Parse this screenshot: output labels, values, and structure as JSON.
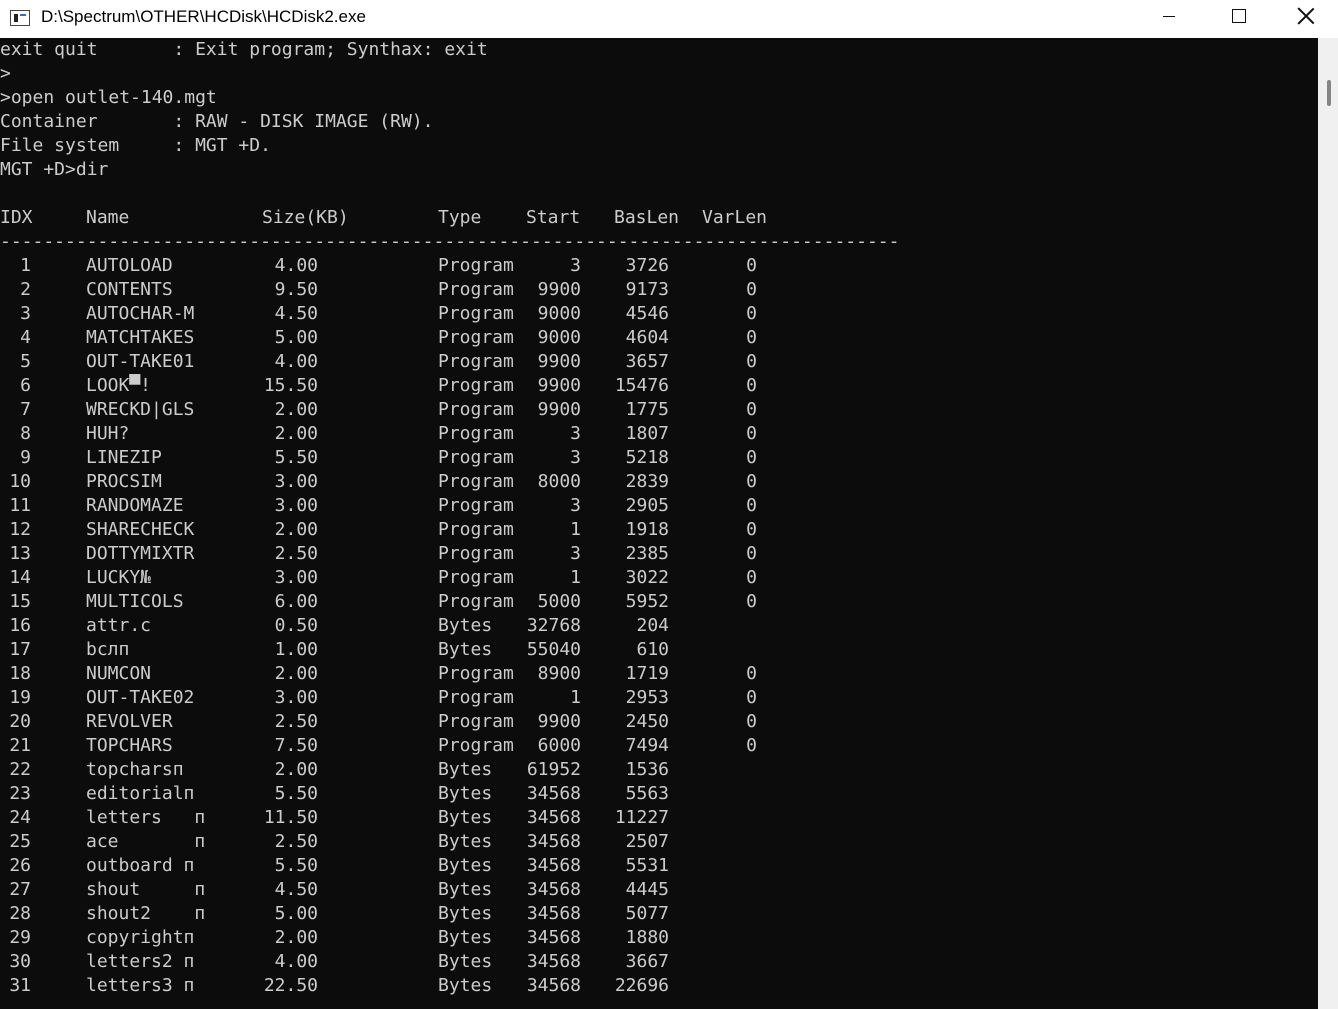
{
  "window": {
    "title": "D:\\Spectrum\\OTHER\\HCDisk\\HCDisk2.exe"
  },
  "console": {
    "pre_lines": [
      "exit quit       : Exit program; Synthax: exit",
      ">",
      ">open outlet-140.mgt",
      "Container       : RAW - DISK IMAGE (RW).",
      "File system     : MGT +D.",
      "MGT +D>dir",
      ""
    ],
    "headers": {
      "idx": "IDX",
      "name": "Name",
      "size": "Size(KB)",
      "type": "Type",
      "start": "Start",
      "baslen": "BasLen",
      "varlen": "VarLen"
    },
    "separator": "-----------------------------------------------------------------------------------",
    "rows": [
      {
        "idx": "1",
        "name": "AUTOLOAD",
        "size": "4.00",
        "type": "Program",
        "start": "3",
        "baslen": "3726",
        "varlen": "0"
      },
      {
        "idx": "2",
        "name": "CONTENTS",
        "size": "9.50",
        "type": "Program",
        "start": "9900",
        "baslen": "9173",
        "varlen": "0"
      },
      {
        "idx": "3",
        "name": "AUTOCHAR-M",
        "size": "4.50",
        "type": "Program",
        "start": "9000",
        "baslen": "4546",
        "varlen": "0"
      },
      {
        "idx": "4",
        "name": "MATCHTAKES",
        "size": "5.00",
        "type": "Program",
        "start": "9000",
        "baslen": "4604",
        "varlen": "0"
      },
      {
        "idx": "5",
        "name": "OUT-TAKE01",
        "size": "4.00",
        "type": "Program",
        "start": "9900",
        "baslen": "3657",
        "varlen": "0"
      },
      {
        "idx": "6",
        "name": "LOOK▀!",
        "size": "15.50",
        "type": "Program",
        "start": "9900",
        "baslen": "15476",
        "varlen": "0"
      },
      {
        "idx": "7",
        "name": "WRECKD|GLS",
        "size": "2.00",
        "type": "Program",
        "start": "9900",
        "baslen": "1775",
        "varlen": "0"
      },
      {
        "idx": "8",
        "name": "HUH?",
        "size": "2.00",
        "type": "Program",
        "start": "3",
        "baslen": "1807",
        "varlen": "0"
      },
      {
        "idx": "9",
        "name": "LINEZIP",
        "size": "5.50",
        "type": "Program",
        "start": "3",
        "baslen": "5218",
        "varlen": "0"
      },
      {
        "idx": "10",
        "name": "PROCSIM",
        "size": "3.00",
        "type": "Program",
        "start": "8000",
        "baslen": "2839",
        "varlen": "0"
      },
      {
        "idx": "11",
        "name": "RANDOMAZE",
        "size": "3.00",
        "type": "Program",
        "start": "3",
        "baslen": "2905",
        "varlen": "0"
      },
      {
        "idx": "12",
        "name": "SHARECHECK",
        "size": "2.00",
        "type": "Program",
        "start": "1",
        "baslen": "1918",
        "varlen": "0"
      },
      {
        "idx": "13",
        "name": "DOTTYMIXTR",
        "size": "2.50",
        "type": "Program",
        "start": "3",
        "baslen": "2385",
        "varlen": "0"
      },
      {
        "idx": "14",
        "name": "LUCKY№",
        "size": "3.00",
        "type": "Program",
        "start": "1",
        "baslen": "3022",
        "varlen": "0"
      },
      {
        "idx": "15",
        "name": "MULTICOLS",
        "size": "6.00",
        "type": "Program",
        "start": "5000",
        "baslen": "5952",
        "varlen": "0"
      },
      {
        "idx": "16",
        "name": "attr.c",
        "size": "0.50",
        "type": "Bytes",
        "start": "32768",
        "baslen": "204",
        "varlen": ""
      },
      {
        "idx": "17",
        "name": "bслп",
        "size": "1.00",
        "type": "Bytes",
        "start": "55040",
        "baslen": "610",
        "varlen": ""
      },
      {
        "idx": "18",
        "name": "NUMCON",
        "size": "2.00",
        "type": "Program",
        "start": "8900",
        "baslen": "1719",
        "varlen": "0"
      },
      {
        "idx": "19",
        "name": "OUT-TAKE02",
        "size": "3.00",
        "type": "Program",
        "start": "1",
        "baslen": "2953",
        "varlen": "0"
      },
      {
        "idx": "20",
        "name": "REVOLVER",
        "size": "2.50",
        "type": "Program",
        "start": "9900",
        "baslen": "2450",
        "varlen": "0"
      },
      {
        "idx": "21",
        "name": "TOPCHARS",
        "size": "7.50",
        "type": "Program",
        "start": "6000",
        "baslen": "7494",
        "varlen": "0"
      },
      {
        "idx": "22",
        "name": "topcharsп",
        "size": "2.00",
        "type": "Bytes",
        "start": "61952",
        "baslen": "1536",
        "varlen": ""
      },
      {
        "idx": "23",
        "name": "editorialп",
        "size": "5.50",
        "type": "Bytes",
        "start": "34568",
        "baslen": "5563",
        "varlen": ""
      },
      {
        "idx": "24",
        "name": "letters   п",
        "size": "11.50",
        "type": "Bytes",
        "start": "34568",
        "baslen": "11227",
        "varlen": ""
      },
      {
        "idx": "25",
        "name": "ace       п",
        "size": "2.50",
        "type": "Bytes",
        "start": "34568",
        "baslen": "2507",
        "varlen": ""
      },
      {
        "idx": "26",
        "name": "outboard п",
        "size": "5.50",
        "type": "Bytes",
        "start": "34568",
        "baslen": "5531",
        "varlen": ""
      },
      {
        "idx": "27",
        "name": "shout     п",
        "size": "4.50",
        "type": "Bytes",
        "start": "34568",
        "baslen": "4445",
        "varlen": ""
      },
      {
        "idx": "28",
        "name": "shout2    п",
        "size": "5.00",
        "type": "Bytes",
        "start": "34568",
        "baslen": "5077",
        "varlen": ""
      },
      {
        "idx": "29",
        "name": "copyrightп",
        "size": "2.00",
        "type": "Bytes",
        "start": "34568",
        "baslen": "1880",
        "varlen": ""
      },
      {
        "idx": "30",
        "name": "letters2 п",
        "size": "4.00",
        "type": "Bytes",
        "start": "34568",
        "baslen": "3667",
        "varlen": ""
      },
      {
        "idx": "31",
        "name": "letters3 п",
        "size": "22.50",
        "type": "Bytes",
        "start": "34568",
        "baslen": "22696",
        "varlen": ""
      }
    ]
  },
  "colors": {
    "console_bg": "#0c0c0c",
    "console_fg": "#cccccc",
    "titlebar_bg": "#ffffff"
  }
}
